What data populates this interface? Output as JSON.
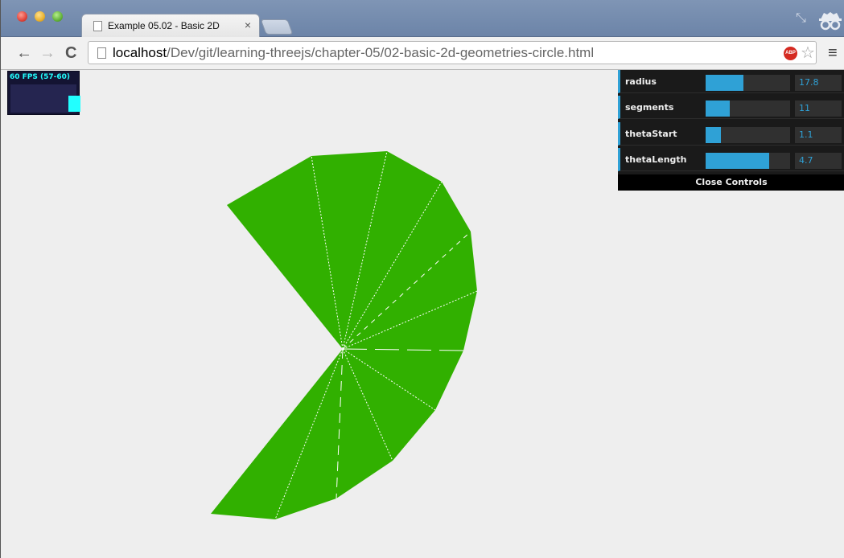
{
  "window": {
    "tab_title": "Example 05.02 - Basic 2D",
    "tab_close": "×",
    "restore_glyph": "⤡"
  },
  "toolbar": {
    "back": "←",
    "forward": "→",
    "reload": "C",
    "url_host": "localhost",
    "url_path": "/Dev/git/learning-threejs/chapter-05/02-basic-2d-geometries-circle.html",
    "abp_label": "ABP",
    "star": "☆",
    "menu": "≡"
  },
  "stats": {
    "fps_text": "60 FPS (57-60)"
  },
  "gui": {
    "controls": [
      {
        "label": "radius",
        "value": "17.8",
        "fraction": 0.45
      },
      {
        "label": "segments",
        "value": "11",
        "fraction": 0.29
      },
      {
        "label": "thetaStart",
        "value": "1.1",
        "fraction": 0.18
      },
      {
        "label": "thetaLength",
        "value": "4.7",
        "fraction": 0.75
      }
    ],
    "close_label": "Close Controls"
  },
  "scene": {
    "mesh_color": "#31b000",
    "wire_color": "#ffffff",
    "background": "#eeeeee"
  }
}
